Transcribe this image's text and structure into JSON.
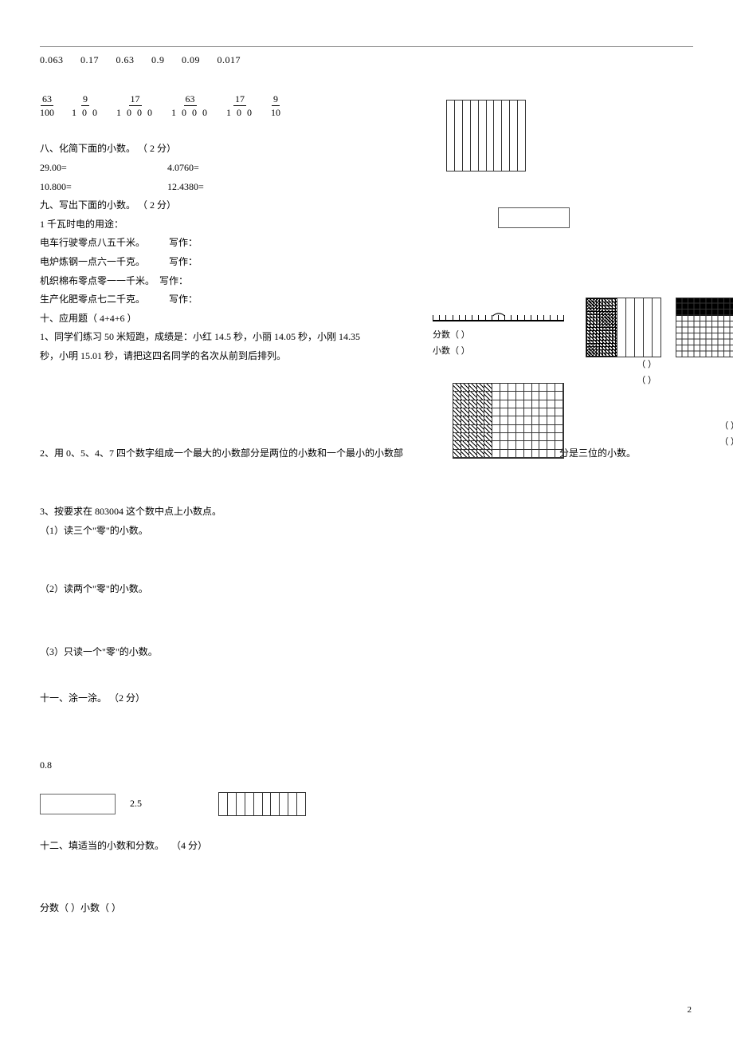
{
  "decimals": [
    "0.063",
    "0.17",
    "0.63",
    "0.9",
    "0.09",
    "0.017"
  ],
  "fractions": [
    {
      "num": "63",
      "den": "100"
    },
    {
      "num": "9",
      "den": "1 0 0"
    },
    {
      "num": "17",
      "den": "1 0 0 0"
    },
    {
      "num": "63",
      "den": "1 0 0 0"
    },
    {
      "num": "17",
      "den": "1 0 0"
    },
    {
      "num": "9",
      "den": "10"
    }
  ],
  "q8": {
    "title": "八、化简下面的小数。",
    "points": "（ 2 分）",
    "rows": [
      {
        "a": "29.00=",
        "b": "4.0760="
      },
      {
        "a": "10.800=",
        "b": "12.4380="
      }
    ]
  },
  "q9": {
    "title": "九、写出下面的小数。",
    "points": "（ 2 分）",
    "lead": "1 千瓦时电的用途：",
    "items": [
      {
        "text": "电车行驶零点八五千米。",
        "label": "写作："
      },
      {
        "text": "电炉炼钢一点六一千克。",
        "label": "写作："
      },
      {
        "text": "机织棉布零点零一一千米。",
        "label": "写作："
      },
      {
        "text": "生产化肥零点七二千克。",
        "label": "写作："
      }
    ]
  },
  "q10": {
    "title": "十、应用题（  4+4+6 ）",
    "p1a": "1、同学们练习    50 米短跑，成绩是：小红   14.5 秒，小丽   14.05 秒，小刚  14.35",
    "p1b": "秒，小明    15.01 秒，请把这四名同学的名次从前到后排列。",
    "p2": "2、用  0、5、4、7 四个数字组成一个最大的小数部分是两位的小数和一个最小的小数部",
    "p2_tail": "分是三位的小数。",
    "p3_head": "3、按要求在    803004 这个数中点上小数点。",
    "p3_1": "（1）读三个\"零\"的小数。",
    "p3_2": "（2）读两个\"零\"的小数。",
    "p3_3": "（3）只读一个\"零\"的小数。"
  },
  "q11": {
    "title": "十一、涂一涂。",
    "points": "（2 分）",
    "v1": "0.8",
    "v2": "2.5"
  },
  "q12": {
    "title": "十二、填适当的小数和分数。",
    "points": "（4 分）",
    "labels": "分数（        ）小数（        ）"
  },
  "ruler_labels": {
    "fenshu": "分数（        ）",
    "xiaoshu": "小数（        ）"
  },
  "paren_a": "（        ）",
  "paren_b": "（        ）",
  "page": "2"
}
